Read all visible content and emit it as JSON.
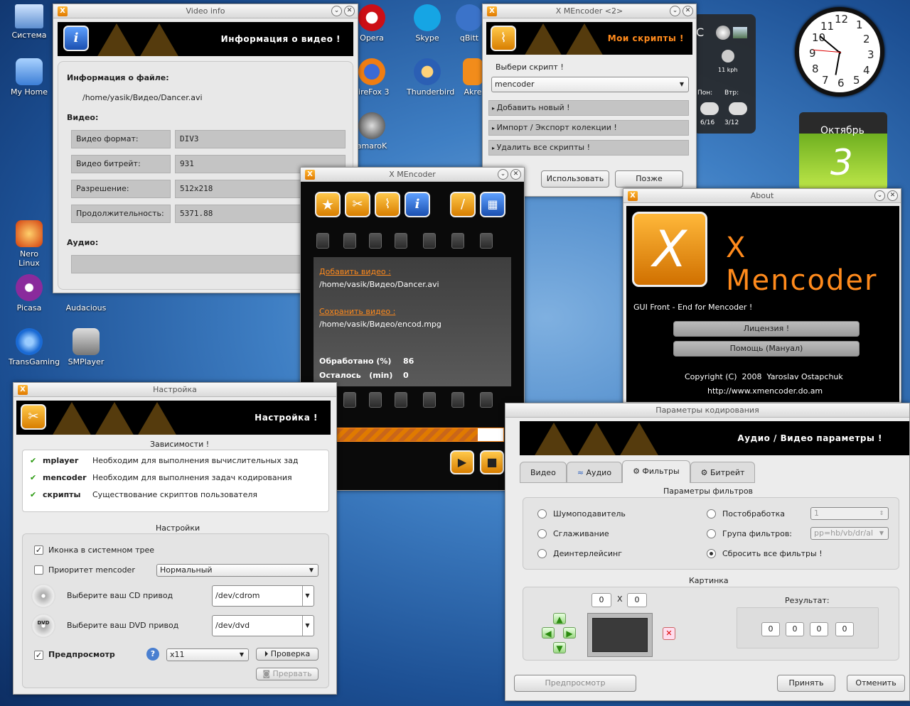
{
  "desktop": {
    "icons": [
      "Система",
      "My Home",
      "Opera",
      "Skype",
      "qBitt",
      "FireFox 3",
      "Thunderbird",
      "Akre",
      "amaroK",
      "Nero Linux",
      "Picasa",
      "Audacious",
      "TransGaming",
      "SMPlayer"
    ],
    "clock": {
      "numbers": [
        "12",
        "1",
        "2",
        "3",
        "4",
        "5",
        "6",
        "7",
        "8",
        "9",
        "10",
        "11"
      ]
    },
    "weather": {
      "speed": "11 kph",
      "d1": "Пон:",
      "d2": "Втр:",
      "t1": "6/16",
      "t2": "3/12",
      "c": "C"
    },
    "calendar": {
      "month": "Октябрь",
      "day": "3"
    }
  },
  "video_info": {
    "title": "Video info",
    "banner": "Информация о видео !",
    "file_label": "Информация о файле:",
    "file_path": "/home/yasik/Видео/Dancer.avi",
    "video_label": "Видео:",
    "rows": [
      {
        "k": "Видео формат:",
        "v": "DIV3"
      },
      {
        "k": "Видео битрейт:",
        "v": "931"
      },
      {
        "k": "Разрешение:",
        "v": "512x218"
      },
      {
        "k": "Продолжительность:",
        "v": "5371.88"
      }
    ],
    "audio_label": "Аудио:"
  },
  "scripts": {
    "title": "X MEncoder <2>",
    "banner": "Мои скрипты !",
    "choose": "Выбери скрипт !",
    "combo": "mencoder",
    "items": [
      "Добавить новый !",
      "Импорт / Экспорт колекции !",
      "Удалить все скрипты !"
    ],
    "use": "Использовать",
    "later": "Позже"
  },
  "main": {
    "title": "X MEncoder",
    "add_label": "Добавить видео :",
    "add_path": "/home/vasik/Видео/Dancer.avi",
    "save_label": "Сохранить видео :",
    "save_path": "/home/vasik/Видео/encod.mpg",
    "processed_label": "Обработано (%)",
    "processed_val": "86",
    "left_label": "Осталось   (min)",
    "left_val": "0",
    "progress": 0.86
  },
  "about": {
    "title": "About",
    "brand": "X Mencoder",
    "tagline": "GUI Front - End for Mencoder !",
    "license": "Лицензия !",
    "help": "Помощь (Мануал)",
    "copyright": "Copyright (C)  2008  Yaroslav Ostapchuk",
    "url": "http://www.xmencoder.do.am"
  },
  "settings": {
    "title": "Настройка",
    "banner": "Настройка !",
    "deps_title": "Зависимости !",
    "deps": [
      {
        "k": "mplayer",
        "v": "Необходим для выполнения вычислительных зад"
      },
      {
        "k": "mencoder",
        "v": "Необходим для выполнения задач кодирования"
      },
      {
        "k": "скрипты",
        "v": "Существование скриптов пользователя"
      }
    ],
    "opts_title": "Настройки",
    "tray": "Иконка в системном трее",
    "priority": "Приоритет mencoder",
    "priority_val": "Нормальный",
    "cd_label": "Выберите ваш CD привод",
    "cd_val": "/dev/cdrom",
    "dvd_label": "Выберите ваш DVD привод",
    "dvd_val": "/dev/dvd",
    "preview": "Предпросмотр",
    "preview_val": "x11",
    "check": "Проверка",
    "abort": "Прервать"
  },
  "encode": {
    "title": "Параметры кодирования",
    "banner": "Аудио / Видео параметры !",
    "tabs": [
      "Видео",
      "Аудио",
      "Фильтры",
      "Битрейт"
    ],
    "filters_title": "Параметры фильтров",
    "left_opts": [
      "Шумоподавитель",
      "Сглаживание",
      "Деинтерлейсинг"
    ],
    "right_opts": [
      "Постобработка",
      "Група фильтров:",
      "Сбросить все фильтры !"
    ],
    "post_val": "1",
    "group_val": "pp=hb/vb/dr/al",
    "picture_title": "Картинка",
    "x_label": "X",
    "w": "0",
    "h": "0",
    "result_label": "Результат:",
    "result": [
      "0",
      "0",
      "0",
      "0"
    ],
    "preview_btn": "Предпросмотр",
    "accept": "Принять",
    "cancel": "Отменить"
  }
}
